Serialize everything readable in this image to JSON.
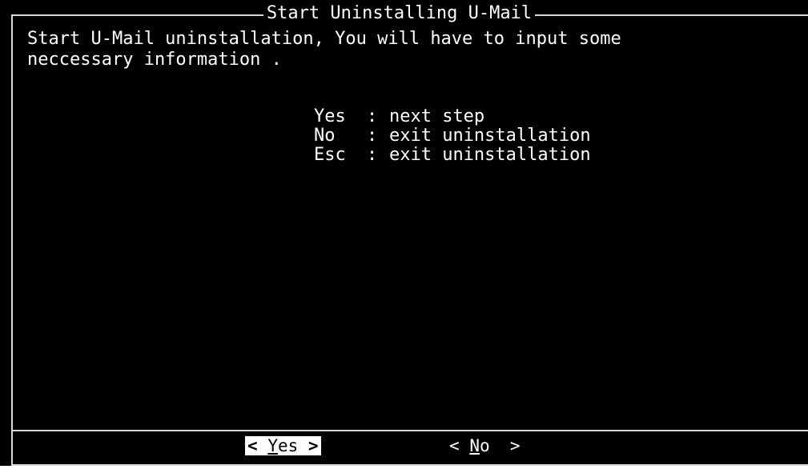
{
  "dialog": {
    "title": "Start Uninstalling U-Mail",
    "intro_line1": "Start U-Mail uninstallation, You will have to input some",
    "intro_line2": "neccessary information ."
  },
  "options": [
    {
      "key": "Yes",
      "sep": ":",
      "desc": "next step"
    },
    {
      "key": "No",
      "sep": ":",
      "desc": "exit uninstallation"
    },
    {
      "key": "Esc",
      "sep": ":",
      "desc": "exit uninstallation"
    }
  ],
  "buttons": {
    "yes": {
      "open": "<",
      "hotkey": "Y",
      "rest": "es",
      "close": ">"
    },
    "no": {
      "open": "<",
      "hotkey": "N",
      "rest": "o",
      "close": ">"
    }
  },
  "colors": {
    "background": "#000000",
    "text": "#ffffff",
    "border": "#d8d8d8",
    "selected_button_bg": "#ffffff",
    "selected_button_fg": "#000000"
  }
}
